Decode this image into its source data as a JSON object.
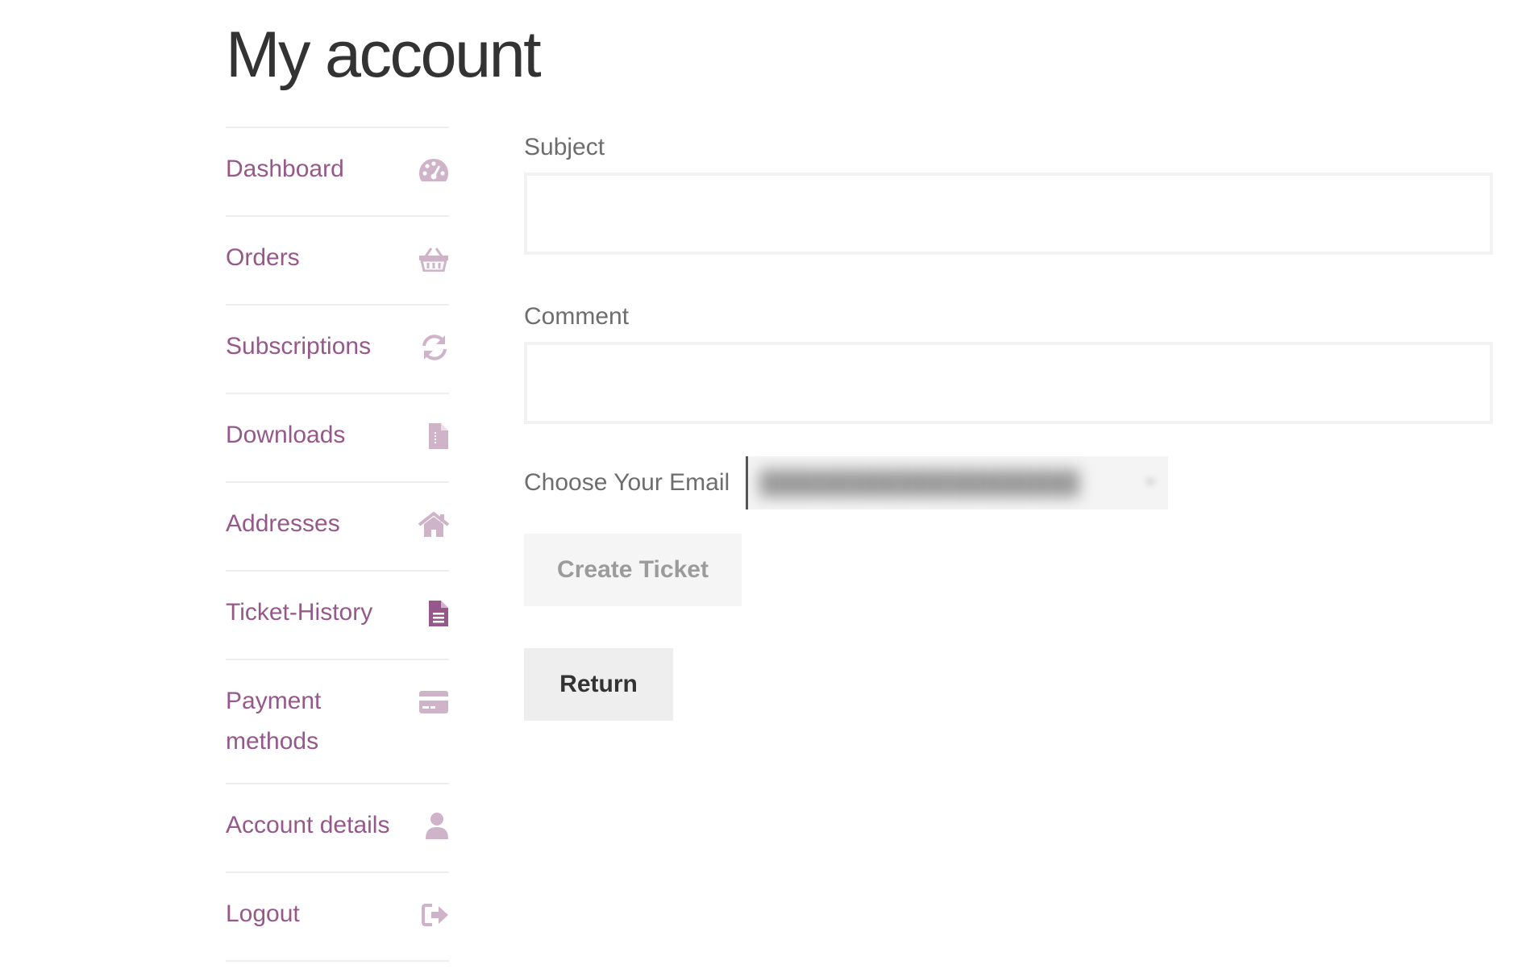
{
  "page": {
    "title": "My account"
  },
  "nav": {
    "items": [
      {
        "label": "Dashboard",
        "icon": "dashboard-icon"
      },
      {
        "label": "Orders",
        "icon": "basket-icon"
      },
      {
        "label": "Subscriptions",
        "icon": "refresh-icon"
      },
      {
        "label": "Downloads",
        "icon": "file-icon"
      },
      {
        "label": "Addresses",
        "icon": "home-icon"
      },
      {
        "label": "Ticket-History",
        "icon": "file-text-icon"
      },
      {
        "label": "Payment methods",
        "icon": "credit-card-icon"
      },
      {
        "label": "Account details",
        "icon": "user-icon"
      },
      {
        "label": "Logout",
        "icon": "sign-out-icon"
      }
    ],
    "active_index": 5
  },
  "form": {
    "subject_label": "Subject",
    "subject_value": "",
    "comment_label": "Comment",
    "comment_value": "",
    "email_label": "Choose Your Email",
    "create_button": "Create Ticket",
    "return_button": "Return"
  },
  "colors": {
    "link": "#96588a",
    "active_icon": "#96588a",
    "label_text": "#6d6d6d"
  }
}
